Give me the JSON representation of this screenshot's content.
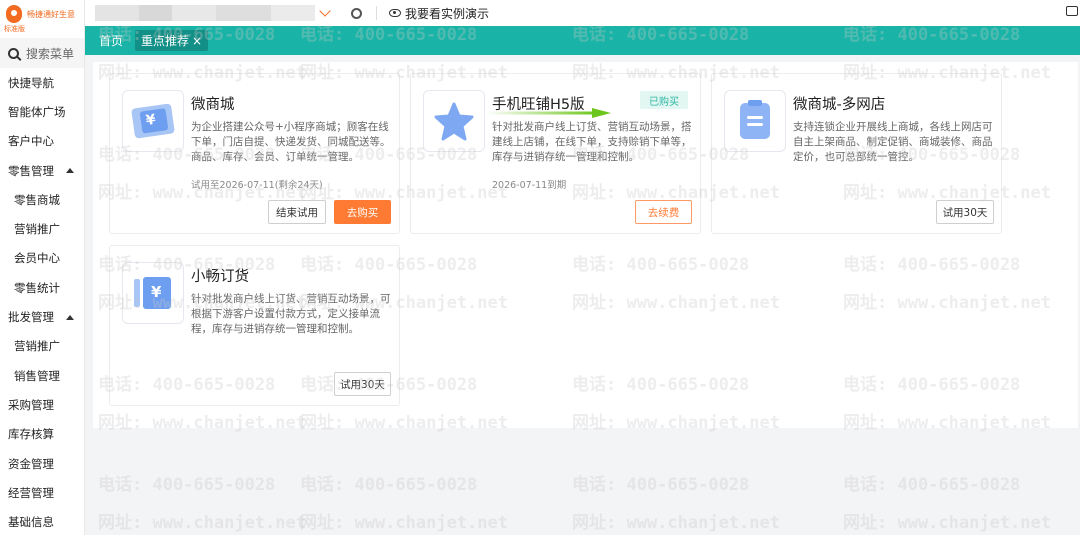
{
  "sidebar": {
    "logo_text": "畅捷通好生意",
    "logo_version": "标准版",
    "search_label": "搜索菜单",
    "items": [
      {
        "label": "快捷导航",
        "level": 1
      },
      {
        "label": "智能体广场",
        "level": 1
      },
      {
        "label": "客户中心",
        "level": 1
      },
      {
        "label": "零售管理",
        "level": 1,
        "expanded": true
      },
      {
        "label": "零售商城",
        "level": 2
      },
      {
        "label": "营销推广",
        "level": 2
      },
      {
        "label": "会员中心",
        "level": 2
      },
      {
        "label": "零售统计",
        "level": 2
      },
      {
        "label": "批发管理",
        "level": 1,
        "expanded": true
      },
      {
        "label": "营销推广",
        "level": 2
      },
      {
        "label": "销售管理",
        "level": 2
      },
      {
        "label": "采购管理",
        "level": 1
      },
      {
        "label": "库存核算",
        "level": 1
      },
      {
        "label": "资金管理",
        "level": 1
      },
      {
        "label": "经营管理",
        "level": 1
      },
      {
        "label": "基础信息",
        "level": 1
      }
    ]
  },
  "header": {
    "demo_label": "我要看实例演示"
  },
  "tabs": {
    "home": "首页",
    "active": "重点推荐",
    "close": "×"
  },
  "cards": [
    {
      "title": "微商城",
      "desc": "为企业搭建公众号+小程序商城；顾客在线下单，门店自提、快递发货、同城配送等。商品、库存、会员、订单统一管理。",
      "note": "试用至2026-07-11(剩余24天)",
      "buttons": [
        "结束试用",
        "去购买"
      ],
      "icon": "ticket-yuan-icon"
    },
    {
      "title": "手机旺铺H5版",
      "badge": "已购买",
      "desc": "针对批发商户线上订货、营销互动场景，搭建线上店铺，在线下单，支持赊销下单等，库存与进销存统一管理和控制。",
      "note": "2026-07-11到期",
      "buttons": [
        "去续费"
      ],
      "icon": "star-icon"
    },
    {
      "title": "微商城-多网店",
      "desc": "支持连锁企业开展线上商城，各线上网店可自主上架商品、制定促销、商城装修、商品定价，也可总部统一管控。",
      "buttons": [
        "试用30天"
      ],
      "icon": "document-icon"
    },
    {
      "title": "小畅订货",
      "desc": "针对批发商户线上订货、营销互动场景，可根据下游客户设置付款方式，定义接单流程，库存与进销存统一管理和控制。",
      "buttons": [
        "试用30天"
      ],
      "icon": "order-book-icon"
    }
  ],
  "watermark": {
    "phone": "电话: 400-665-0028",
    "site": "网址: www.chanjet.net"
  },
  "colors": {
    "teal": "#19b4a7",
    "orange": "#ff7a33",
    "green_arrow": "#6cc61c"
  }
}
